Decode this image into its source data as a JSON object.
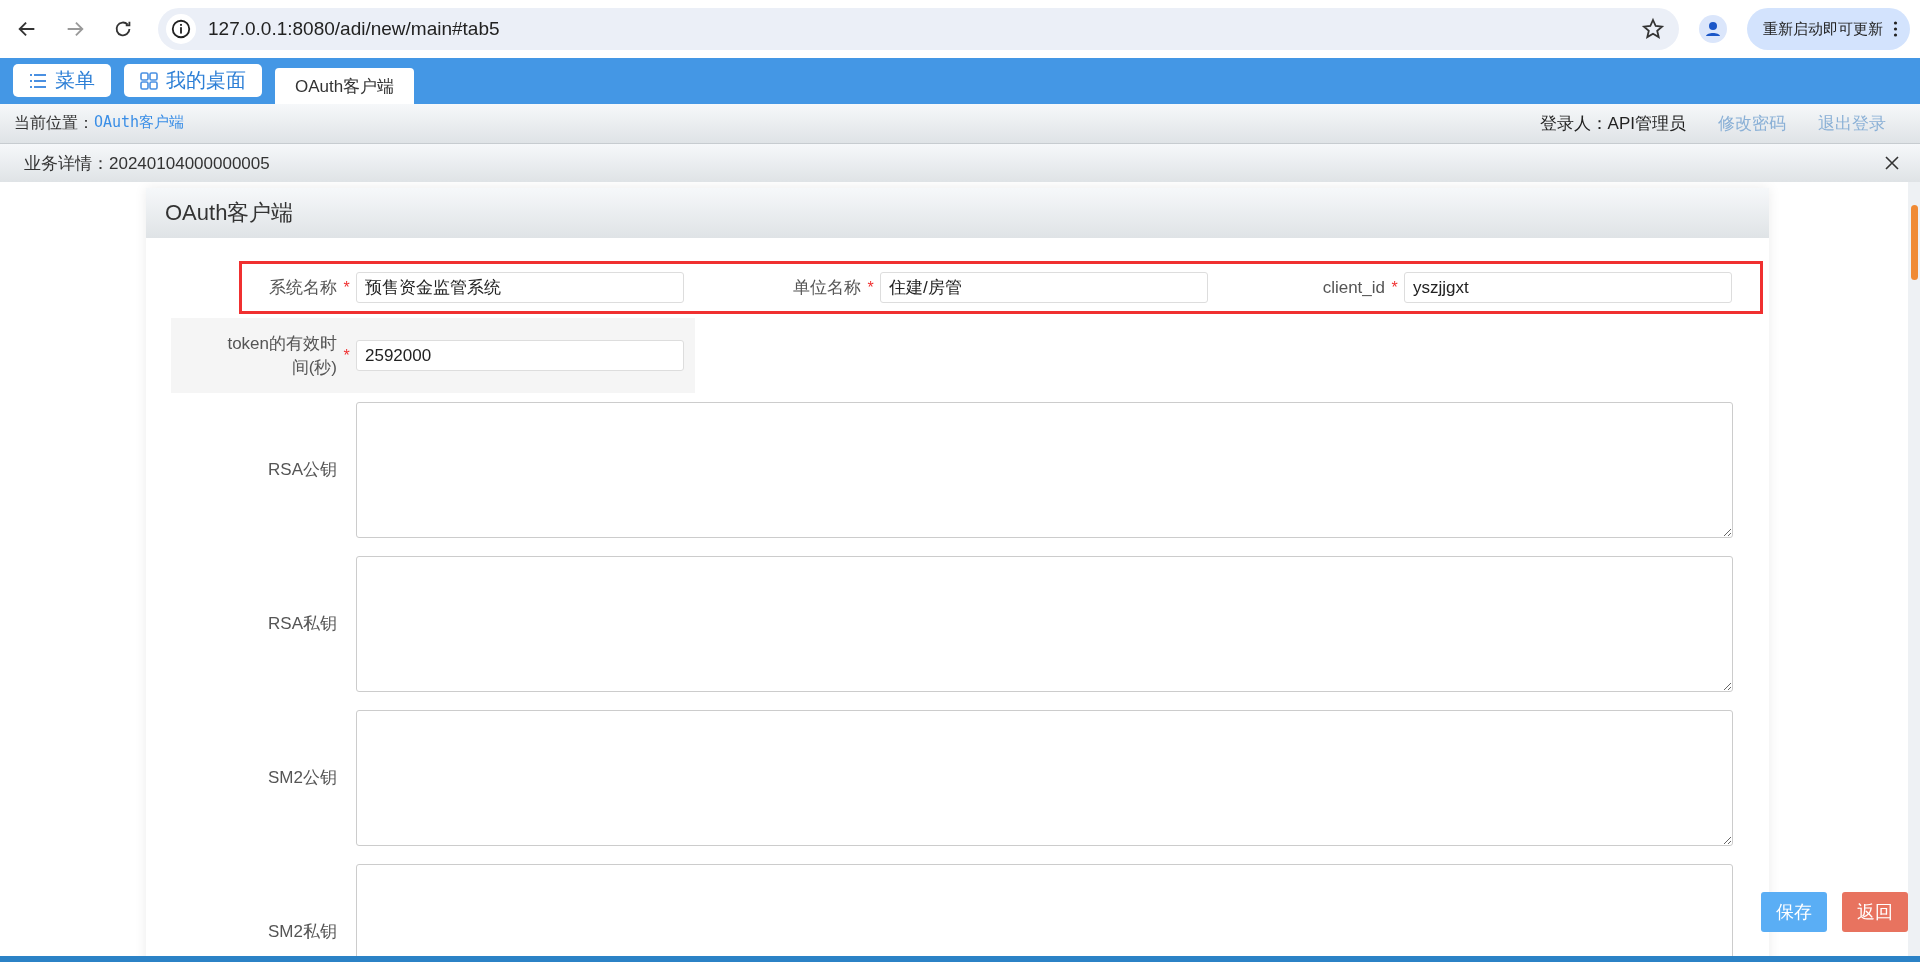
{
  "browser": {
    "url": "127.0.0.1:8080/adi/new/main#tab5",
    "update_button": "重新启动即可更新"
  },
  "topbar": {
    "buttons": [
      {
        "label": "菜单"
      },
      {
        "label": "我的桌面"
      }
    ],
    "tabs": [
      {
        "label": "OAuth客户端",
        "selected": true
      }
    ]
  },
  "breadcrumb": {
    "prefix": "当前位置：",
    "current": "OAuth客户端",
    "user": "登录人：API管理员",
    "links": [
      "修改密码",
      "退出登录"
    ]
  },
  "detail_bar": {
    "title": "业务详情：20240104000000005"
  },
  "panel": {
    "title": "OAuth客户端",
    "rows": [
      {
        "highlighted": true,
        "fields": [
          {
            "kind": "input",
            "label": "系统名称",
            "required_mark": "*",
            "value": "预售资金监管系统"
          },
          {
            "kind": "input",
            "label": "单位名称",
            "required_mark": "*",
            "value": "住建/房管"
          },
          {
            "kind": "input",
            "label": "client_id",
            "required_mark": "*",
            "value": "yszjjgxt"
          }
        ]
      },
      {
        "shaded": true,
        "fields": [
          {
            "kind": "input",
            "label": "token的有效时间(秒)",
            "required_mark": "*",
            "value": "2592000"
          }
        ]
      },
      {
        "fields": [
          {
            "kind": "textarea",
            "label": "RSA公钥"
          }
        ]
      },
      {
        "fields": [
          {
            "kind": "textarea",
            "label": "RSA私钥"
          }
        ]
      },
      {
        "fields": [
          {
            "kind": "textarea",
            "label": "SM2公钥"
          }
        ]
      },
      {
        "fields": [
          {
            "kind": "textarea",
            "label": "SM2私钥"
          }
        ]
      }
    ]
  },
  "actions": [
    {
      "label": "保存",
      "kind": "primary"
    },
    {
      "label": "返回",
      "kind": "danger"
    }
  ]
}
